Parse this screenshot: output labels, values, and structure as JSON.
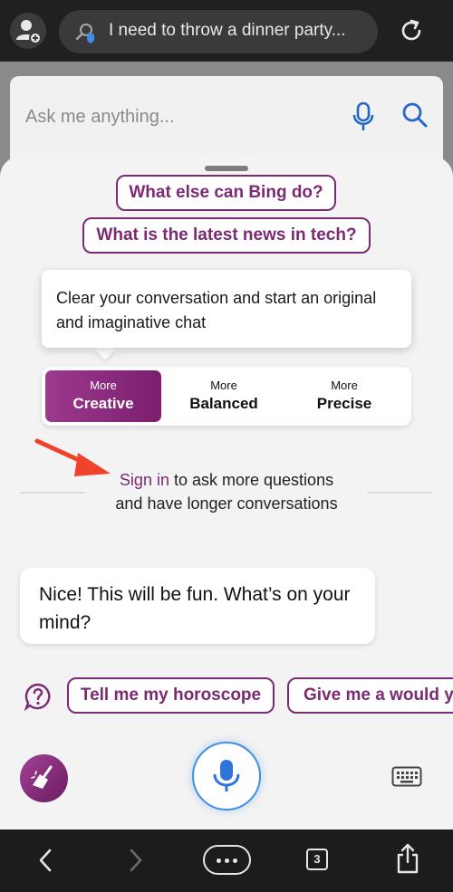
{
  "browser": {
    "address_text": "I need to throw a dinner party...",
    "tab_count": "3"
  },
  "search": {
    "placeholder": "Ask me anything..."
  },
  "suggestions_top": [
    "What else can Bing do?",
    "What is the latest news in tech?"
  ],
  "tooltip": {
    "text": "Clear your conversation and start an original and imaginative chat"
  },
  "modes": [
    {
      "small": "More",
      "large": "Creative",
      "active": true
    },
    {
      "small": "More",
      "large": "Balanced",
      "active": false
    },
    {
      "small": "More",
      "large": "Precise",
      "active": false
    }
  ],
  "signin": {
    "link": "Sign in",
    "rest_line1": "to ask more questions",
    "rest_line2": "and have longer conversations"
  },
  "bot_message": "Nice! This will be fun. What’s on your mind?",
  "suggestions_bottom": [
    "Tell me my horoscope",
    "Give me a would you rather question"
  ],
  "colors": {
    "accent": "#7b2a73",
    "mic_ring": "#3f8fe8",
    "arrow": "#f0432c"
  },
  "icons": [
    "add-user-icon",
    "shield-search-icon",
    "reload-icon",
    "mic-icon",
    "search-icon",
    "arrow-icon",
    "help-icon",
    "broom-icon",
    "keyboard-icon",
    "back-icon",
    "forward-icon",
    "more-icon",
    "tabs-icon",
    "share-icon"
  ]
}
